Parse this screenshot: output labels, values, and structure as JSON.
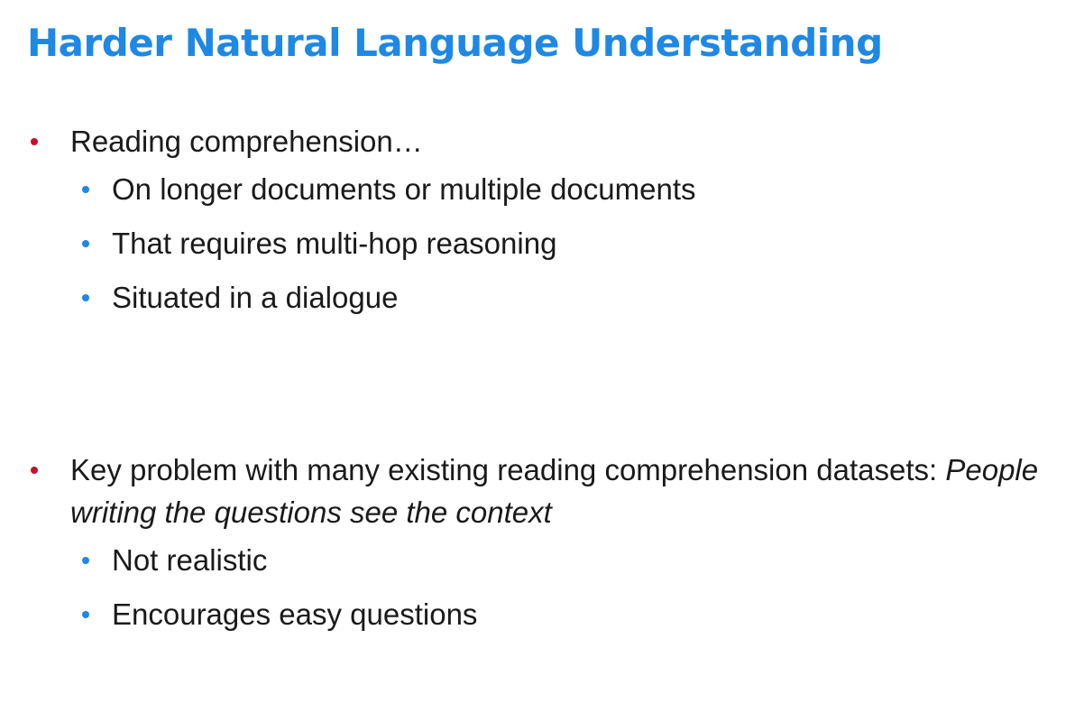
{
  "slide": {
    "title": "Harder Natural Language Understanding",
    "colors": {
      "title": "#1e88e5",
      "level1_bullet": "#c8102e",
      "level2_bullet": "#1e88e5",
      "text": "#1a1a1a"
    },
    "bullets": [
      {
        "text": "Reading comprehension…",
        "sub": [
          "On longer documents or multiple documents",
          "That requires multi-hop reasoning",
          "Situated in a dialogue"
        ]
      },
      {
        "text": "Key problem with many existing reading comprehension datasets:",
        "emphasis": "People writing the questions see the context",
        "sub": [
          "Not realistic",
          "Encourages easy questions"
        ]
      }
    ]
  }
}
